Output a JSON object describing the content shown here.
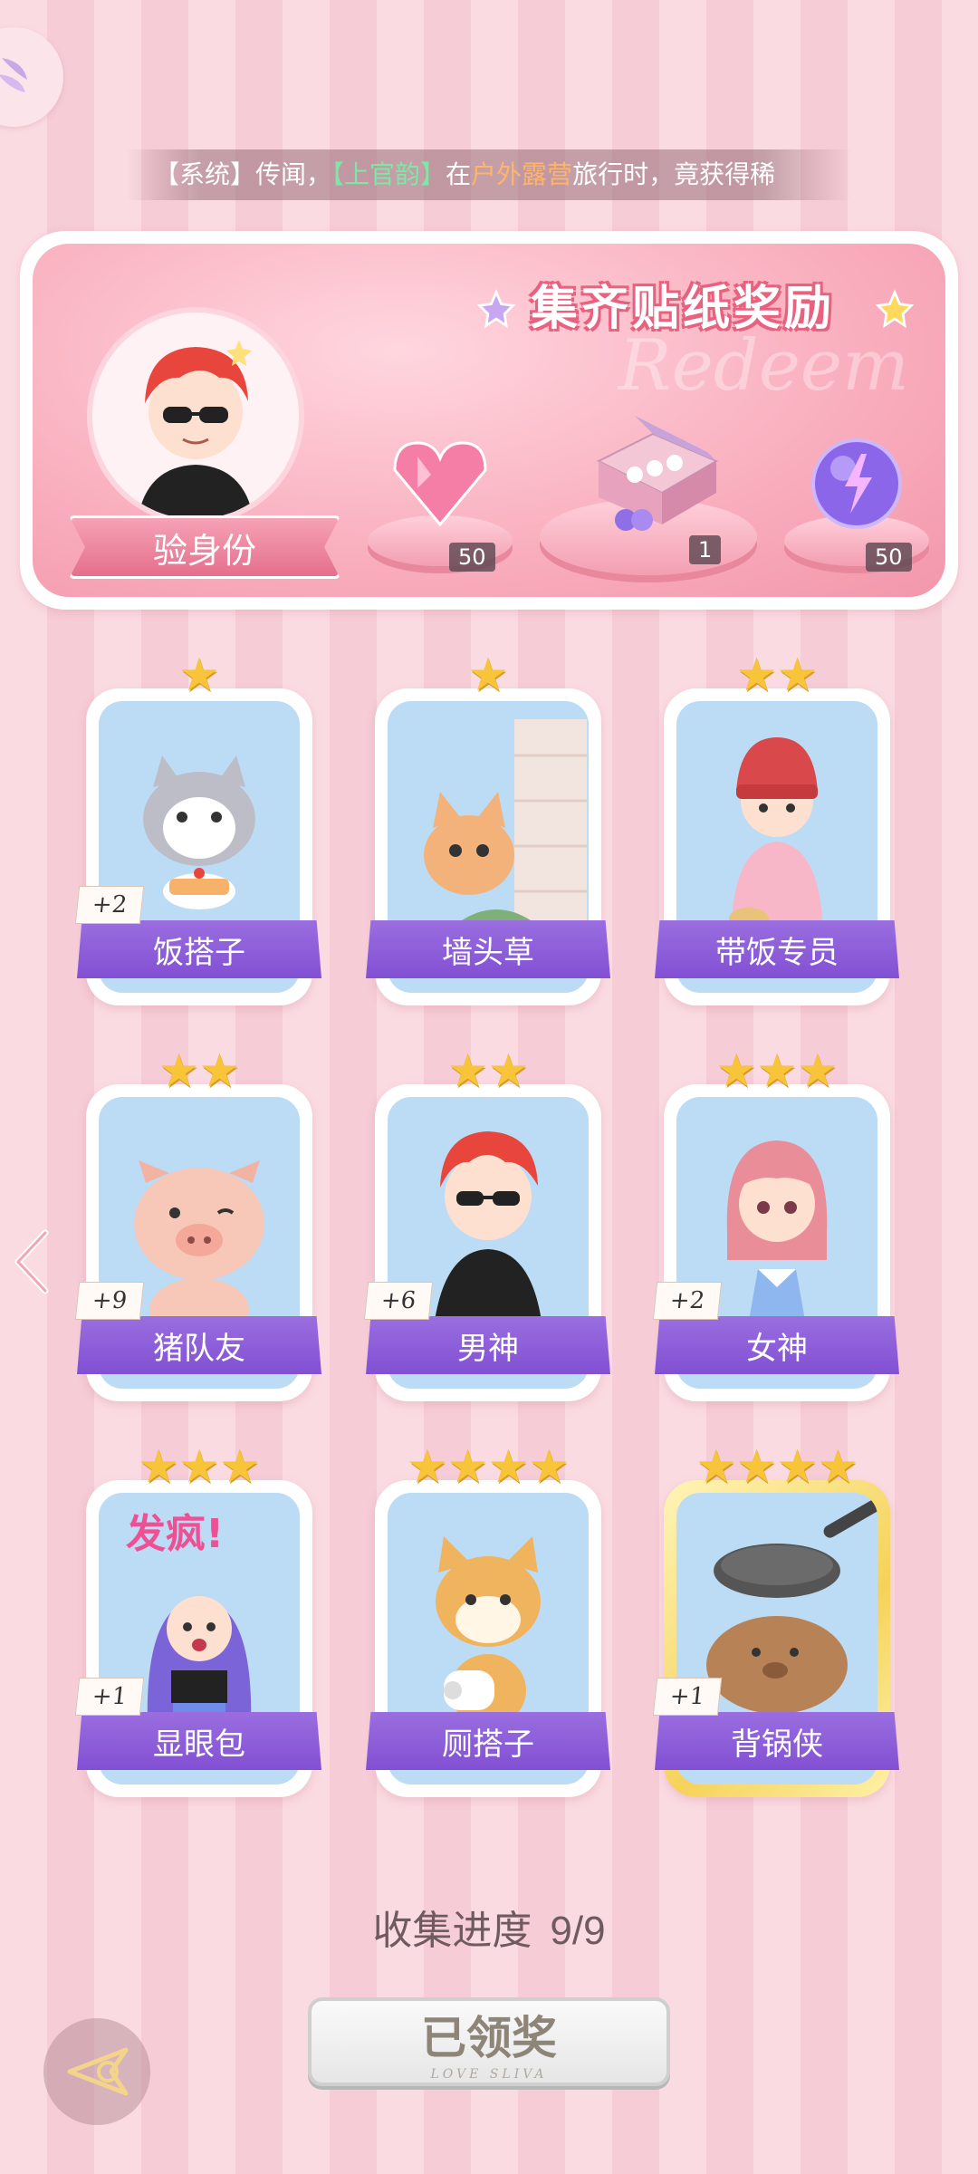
{
  "ticker": {
    "prefix": "【系统】传闻，",
    "name": "【上官韵】",
    "mid": "在",
    "place": "户外露营",
    "suffix": "旅行时，竟获得稀"
  },
  "banner": {
    "title": "集齐贴纸奖励",
    "watermark": "Redeem",
    "identity_label": "验身份",
    "rewards": [
      {
        "icon": "pink-diamond-icon",
        "count": "50"
      },
      {
        "icon": "gift-box-icon",
        "count": "1"
      },
      {
        "icon": "energy-orb-icon",
        "count": "50"
      }
    ]
  },
  "cards": [
    {
      "label": "饭搭子",
      "stars": 1,
      "plus": "+2",
      "art": "cat-with-cake"
    },
    {
      "label": "墙头草",
      "stars": 1,
      "plus": "",
      "art": "cat-on-wall"
    },
    {
      "label": "带饭专员",
      "stars": 2,
      "plus": "",
      "art": "girl-with-beanie"
    },
    {
      "label": "猪队友",
      "stars": 2,
      "plus": "+9",
      "art": "pig"
    },
    {
      "label": "男神",
      "stars": 2,
      "plus": "+6",
      "art": "boy-with-sunglasses"
    },
    {
      "label": "女神",
      "stars": 3,
      "plus": "+2",
      "art": "girl-pink-hair"
    },
    {
      "label": "显眼包",
      "stars": 3,
      "plus": "+1",
      "art": "crazy-girl"
    },
    {
      "label": "厕搭子",
      "stars": 4,
      "plus": "",
      "art": "shiba-toilet-paper"
    },
    {
      "label": "背锅侠",
      "stars": 4,
      "plus": "+1",
      "art": "capybara-with-pan"
    }
  ],
  "progress": {
    "label": "收集进度",
    "value": "9/9"
  },
  "claim_button": {
    "label": "已领奖",
    "sub": "LOVE SLIVA"
  },
  "colors": {
    "label_purple": "#8250d3",
    "banner_pink": "#f397ab",
    "star_gold": "#f8c53a"
  }
}
